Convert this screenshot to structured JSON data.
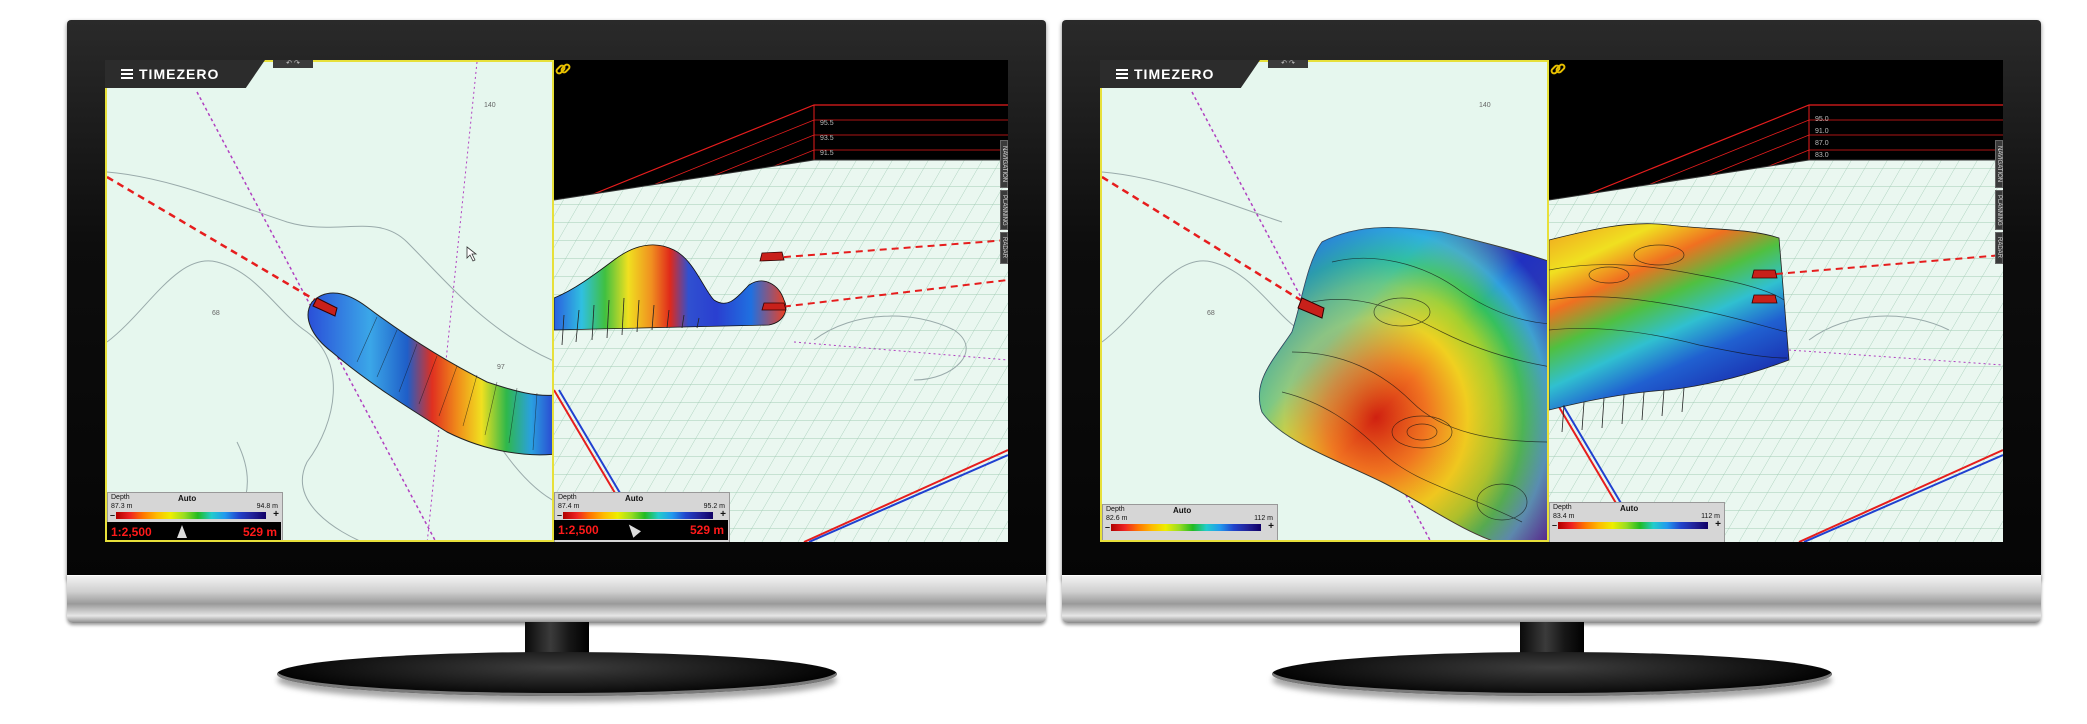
{
  "monitors": [
    {
      "app_title": "TIMEZERO",
      "undo_label": "↶  ↷",
      "chart2d": {
        "depth_labels": [
          "140",
          "68",
          "97"
        ],
        "legend": {
          "title": "Depth",
          "mode": "Auto",
          "min": "87.3 m",
          "max": "94.8 m"
        },
        "scale": {
          "left": "1:2,500",
          "right": "529 m"
        }
      },
      "view3d": {
        "grid_labels": [
          "95.5",
          "93.5",
          "91.5"
        ],
        "legend": {
          "title": "Depth",
          "mode": "Auto",
          "min": "87.4 m",
          "max": "95.2 m"
        },
        "scale": {
          "left": "1:2,500",
          "right": "529 m"
        },
        "side_tabs": [
          "NAVIGATION",
          "PLANNING",
          "RADAR"
        ]
      }
    },
    {
      "app_title": "TIMEZERO",
      "undo_label": "↶  ↷",
      "chart2d": {
        "depth_labels": [
          "140",
          "68"
        ],
        "legend": {
          "title": "Depth",
          "mode": "Auto",
          "min": "82.6 m",
          "max": "112 m"
        }
      },
      "view3d": {
        "grid_labels": [
          "95.0",
          "91.0",
          "87.0",
          "83.0"
        ],
        "legend": {
          "title": "Depth",
          "mode": "Auto",
          "min": "83.4 m",
          "max": "112 m"
        },
        "side_tabs": [
          "NAVIGATION",
          "PLANNING",
          "RADAR"
        ]
      }
    }
  ],
  "colors": {
    "route": "#e61d1d",
    "boat": "#c8201a",
    "highlight_border": "#e7e03a",
    "chart_bg": "#e6f7ee",
    "scale_text": "#ff1a1a"
  },
  "icons": [
    "menu-icon",
    "undo-icon",
    "redo-icon",
    "north-arrow-icon",
    "link-icon",
    "boat-icon",
    "cursor-icon"
  ]
}
